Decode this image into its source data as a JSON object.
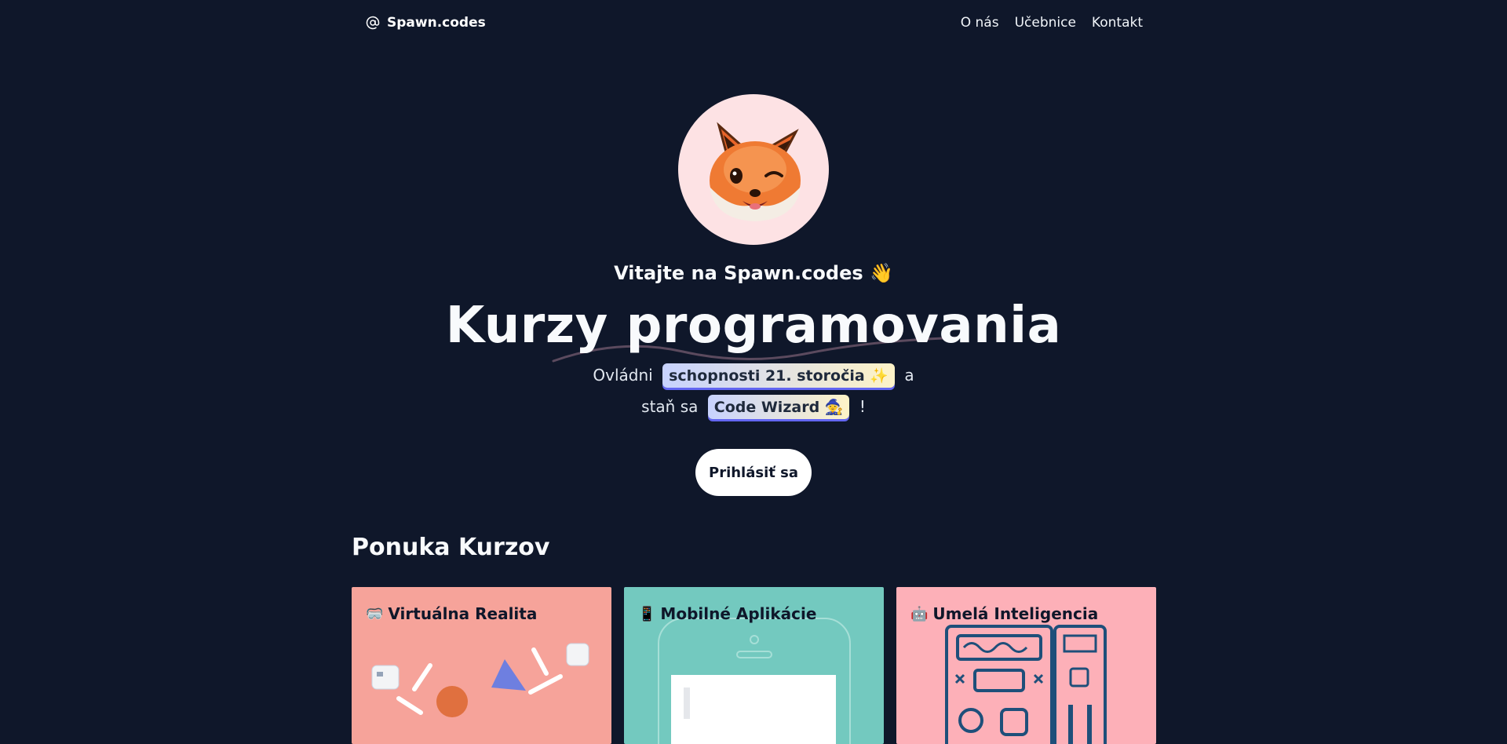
{
  "nav": {
    "brand": "Spawn.codes",
    "links": [
      "O nás",
      "Učebnice",
      "Kontakt"
    ]
  },
  "hero": {
    "welcome": "Vitajte na Spawn.codes 👋",
    "title": "Kurzy programovania",
    "line1_pre": "Ovládni",
    "chip1": "schopnosti 21. storočia ✨",
    "line1_post": "a",
    "line2_pre": "staň sa",
    "chip2": "Code Wizard 🧙",
    "line2_post": "!",
    "login": "Prihlásiť sa"
  },
  "courses": {
    "title": "Ponuka Kurzov",
    "items": [
      {
        "icon": "🥽",
        "label": "Virtuálna Realita",
        "color": "#f6a39a"
      },
      {
        "icon": "📱",
        "label": "Mobilné Aplikácie",
        "color": "#73c9bf"
      },
      {
        "icon": "🤖",
        "label": "Umelá Inteligencia",
        "color": "#fdb0b8"
      }
    ]
  },
  "colors": {
    "background": "#0f172a",
    "accent": "#6366f1"
  }
}
